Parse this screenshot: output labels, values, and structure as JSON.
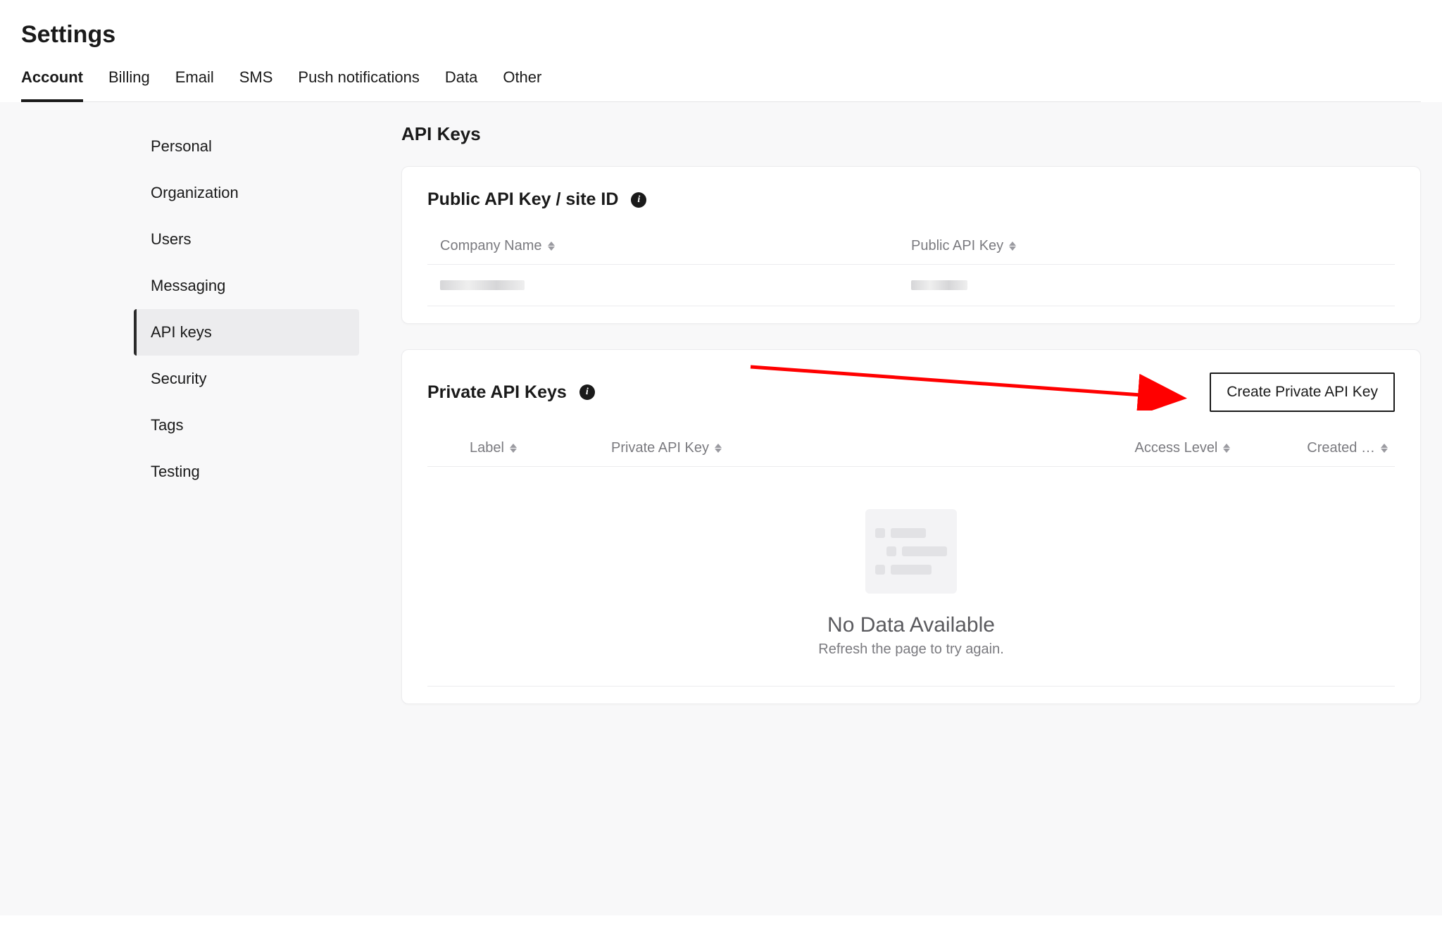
{
  "header": {
    "title": "Settings",
    "tabs": [
      {
        "label": "Account",
        "active": true
      },
      {
        "label": "Billing",
        "active": false
      },
      {
        "label": "Email",
        "active": false
      },
      {
        "label": "SMS",
        "active": false
      },
      {
        "label": "Push notifications",
        "active": false
      },
      {
        "label": "Data",
        "active": false
      },
      {
        "label": "Other",
        "active": false
      }
    ]
  },
  "sidebar": {
    "items": [
      {
        "label": "Personal",
        "active": false
      },
      {
        "label": "Organization",
        "active": false
      },
      {
        "label": "Users",
        "active": false
      },
      {
        "label": "Messaging",
        "active": false
      },
      {
        "label": "API keys",
        "active": true
      },
      {
        "label": "Security",
        "active": false
      },
      {
        "label": "Tags",
        "active": false
      },
      {
        "label": "Testing",
        "active": false
      }
    ]
  },
  "main": {
    "title": "API Keys",
    "public_card": {
      "title": "Public API Key / site ID",
      "columns": {
        "name": "Company Name",
        "key": "Public API Key"
      },
      "rows": [
        {
          "name_redacted": true,
          "key_redacted": true
        }
      ]
    },
    "private_card": {
      "title": "Private API Keys",
      "create_button": "Create Private API Key",
      "columns": {
        "label": "Label",
        "key": "Private API Key",
        "access": "Access Level",
        "created": "Created …"
      },
      "empty": {
        "title": "No Data Available",
        "subtitle": "Refresh the page to try again."
      }
    }
  },
  "annotation": {
    "arrow_color": "#ff0000"
  }
}
